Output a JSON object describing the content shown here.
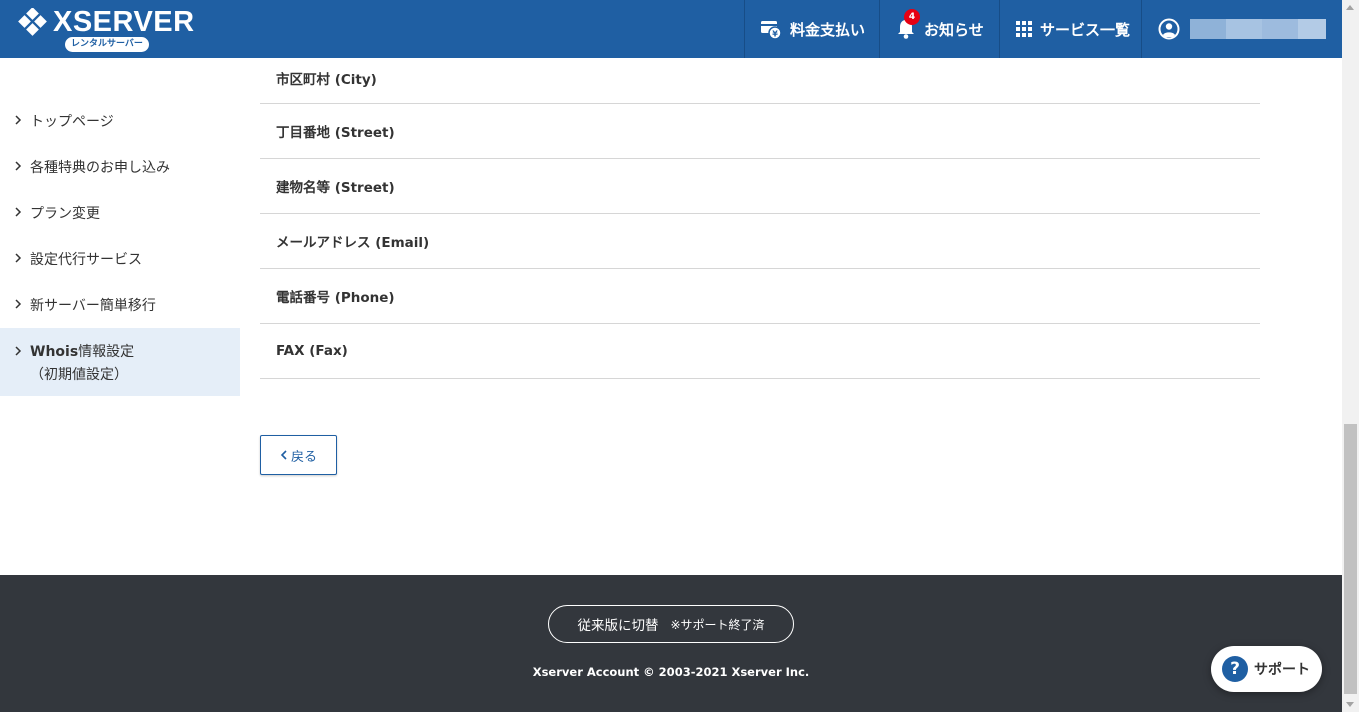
{
  "header": {
    "logo_text": "XSERVER",
    "logo_sub": "レンタルサーバー",
    "nav": {
      "payment": "料金支払い",
      "news": "お知らせ",
      "news_badge": "4",
      "services": "サービス一覧"
    }
  },
  "sidebar": {
    "items": [
      {
        "label": "トップページ"
      },
      {
        "label": "各種特典のお申し込み"
      },
      {
        "label": "プラン変更"
      },
      {
        "label": "設定代行サービス"
      },
      {
        "label": "新サーバー簡単移行"
      }
    ],
    "active": {
      "label_bold": "Whois",
      "label_rest": "情報設定",
      "label_line2": "（初期値設定）"
    }
  },
  "form_rows": [
    {
      "label": "市区町村 (City)"
    },
    {
      "label": "丁目番地 (Street)"
    },
    {
      "label": "建物名等 (Street)"
    },
    {
      "label": "メールアドレス (Email)"
    },
    {
      "label": "電話番号 (Phone)"
    },
    {
      "label": "FAX (Fax)"
    }
  ],
  "back_button": "戻る",
  "footer": {
    "switch_label": "従来版に切替",
    "switch_note": "※サポート終了済",
    "copyright": "Xserver Account © 2003-2021 Xserver Inc."
  },
  "support_button": "サポート",
  "colors": {
    "brand": "#1f5fa3",
    "footer": "#33373d",
    "active_bg": "#e5eef8",
    "badge": "#e60012"
  }
}
